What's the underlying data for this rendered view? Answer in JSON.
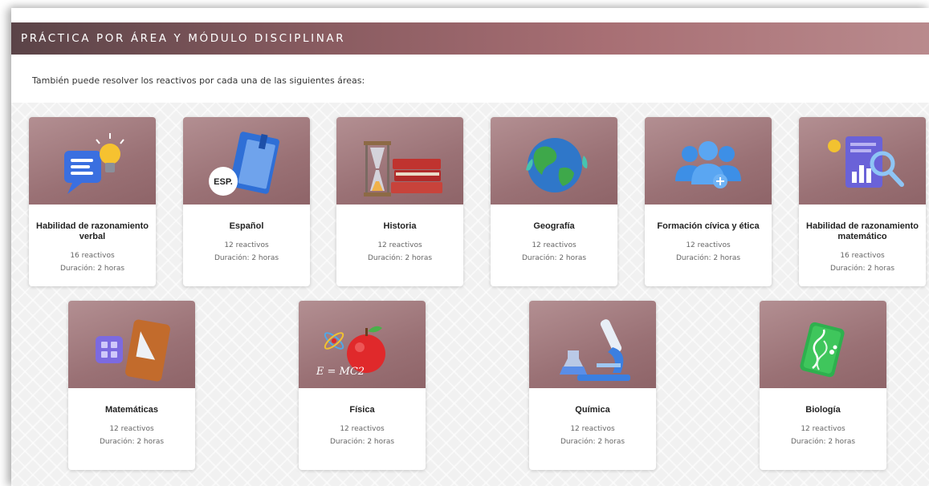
{
  "header": {
    "title": "PRÁCTICA POR ÁREA Y MÓDULO DISCIPLINAR"
  },
  "intro": "También puede resolver los reactivos por cada una de las siguientes áreas:",
  "cards": [
    {
      "name": "Habilidad de razonamiento verbal",
      "count": "16 reactivos",
      "duration": "Duración: 2 horas",
      "icon": "speech-bubble-lightbulb-icon"
    },
    {
      "name": "Español",
      "count": "12 reactivos",
      "duration": "Duración: 2 horas",
      "icon": "book-esp-icon",
      "icon_text": "ESP."
    },
    {
      "name": "Historia",
      "count": "12 reactivos",
      "duration": "Duración: 2 horas",
      "icon": "hourglass-books-icon"
    },
    {
      "name": "Geografía",
      "count": "12 reactivos",
      "duration": "Duración: 2 horas",
      "icon": "globe-icon"
    },
    {
      "name": "Formación cívica y ética",
      "count": "12 reactivos",
      "duration": "Duración: 2 horas",
      "icon": "people-group-icon"
    },
    {
      "name": "Habilidad de razonamiento matemático",
      "count": "16 reactivos",
      "duration": "Duración: 2 horas",
      "icon": "chart-magnifier-icon"
    },
    {
      "name": "Matemáticas",
      "count": "12 reactivos",
      "duration": "Duración: 2 horas",
      "icon": "calculator-ruler-icon"
    },
    {
      "name": "Física",
      "count": "12 reactivos",
      "duration": "Duración: 2 horas",
      "icon": "apple-atom-icon",
      "icon_text": "E = MC2"
    },
    {
      "name": "Química",
      "count": "12 reactivos",
      "duration": "Duración: 2 horas",
      "icon": "microscope-flask-icon"
    },
    {
      "name": "Biología",
      "count": "12 reactivos",
      "duration": "Duración: 2 horas",
      "icon": "dna-card-icon"
    }
  ],
  "colors": {
    "header_start": "#5a4347",
    "header_end": "#b98a8d",
    "card_image": "#9a7175"
  }
}
